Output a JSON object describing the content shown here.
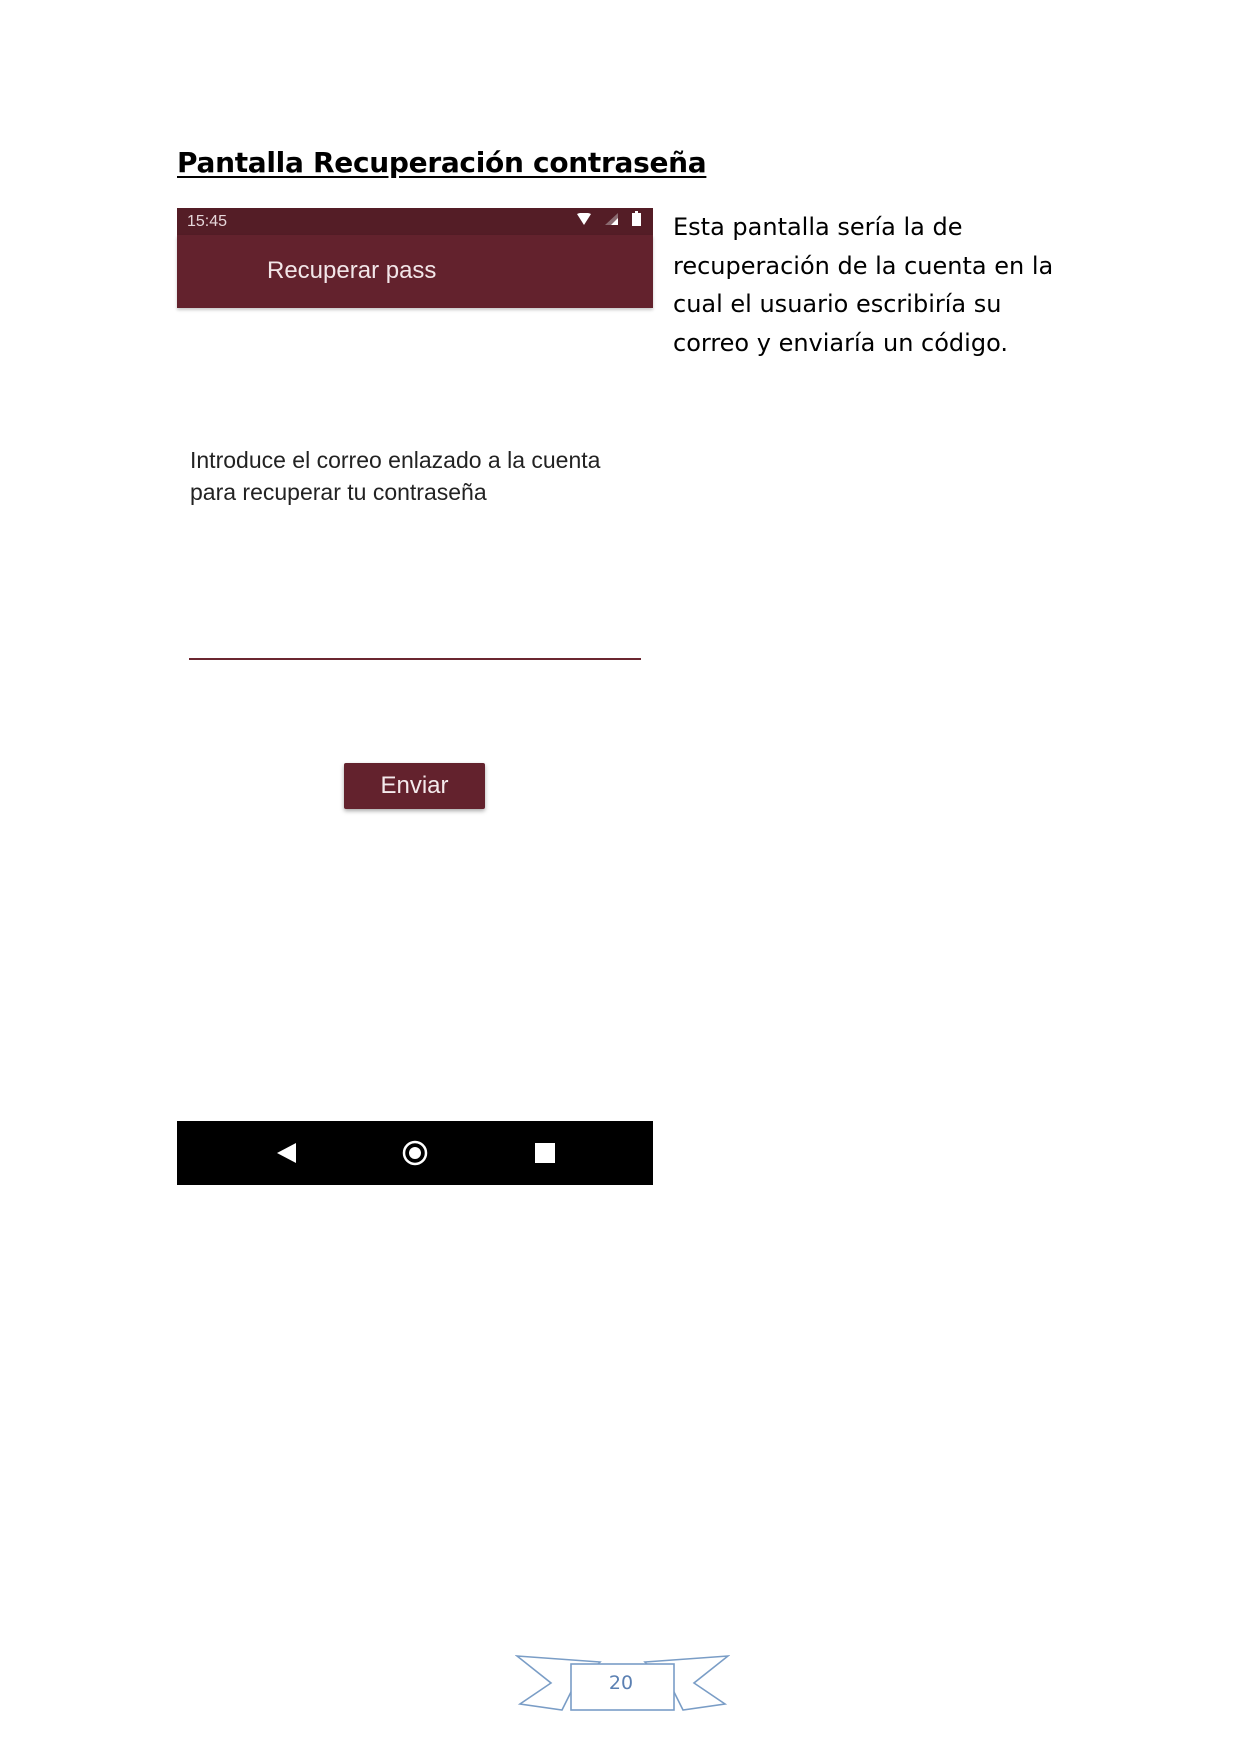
{
  "heading": "Pantalla Recuperación contraseña",
  "phone": {
    "status_time": "15:45",
    "app_title": "Recuperar pass",
    "instruction": "Introduce el correo enlazado a la cuenta para recuperar tu contraseña",
    "email_value": "",
    "send_label": "Enviar",
    "status_icons": [
      "wifi-icon",
      "signal-icon",
      "battery-icon"
    ],
    "nav_icons": [
      "back-icon",
      "home-icon",
      "recents-icon"
    ]
  },
  "description": "Esta pantalla sería la de recuperación de la cuenta en la cual el usuario escribiría su correo y enviaría un código.",
  "page_number": "20",
  "colors": {
    "status_bar": "#541d26",
    "app_bar": "#63222d",
    "accent": "#63222d",
    "nav_bar": "#000000",
    "page_number": "#5b80b2"
  }
}
